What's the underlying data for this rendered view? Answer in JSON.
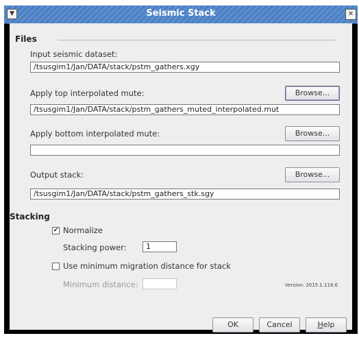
{
  "window": {
    "title": "Seismic Stack"
  },
  "files": {
    "section_title": "Files",
    "input_label": "Input seismic dataset:",
    "input_value": "/tsusgim1/Jan/DATA/stack/pstm_gathers.xgy",
    "top_mute_label": "Apply top interpolated mute:",
    "top_mute_value": "/tsusgim1/Jan/DATA/stack/pstm_gathers_muted_interpolated.mut",
    "bottom_mute_label": "Apply bottom interpolated mute:",
    "bottom_mute_value": "",
    "output_label": "Output stack:",
    "output_value": "/tsusgim1/Jan/DATA/stack/pstm_gathers_stk.sgy",
    "browse_label": "Browse..."
  },
  "stacking": {
    "section_title": "Stacking",
    "normalize_label": "Normalize",
    "normalize_checked": true,
    "power_label": "Stacking power:",
    "power_value": "1",
    "min_migration_label": "Use minimum migration distance for stack",
    "min_migration_checked": false,
    "min_distance_label": "Minimum distance:",
    "min_distance_value": ""
  },
  "version": "Version: 2015.1.116.6",
  "buttons": {
    "ok": "OK",
    "cancel": "Cancel",
    "help_first": "H",
    "help_rest": "elp"
  },
  "icons": {
    "menu": "chevron-down-icon",
    "close": "close-icon",
    "check": "check-icon"
  }
}
